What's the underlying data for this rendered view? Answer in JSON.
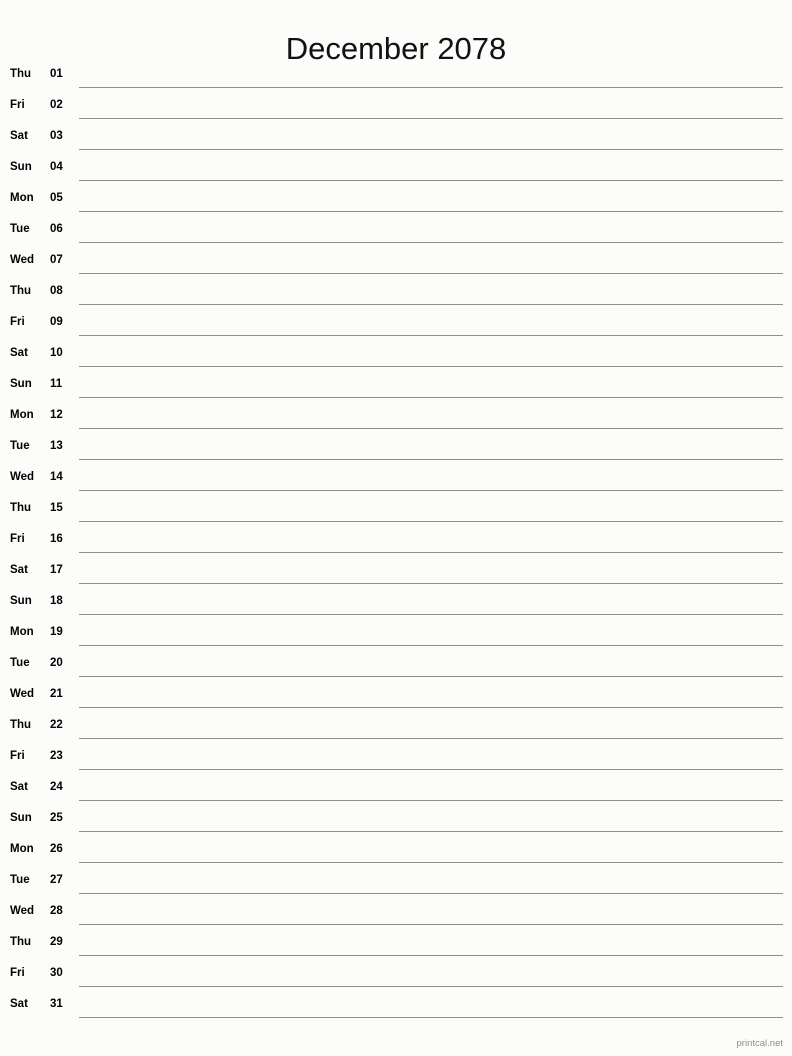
{
  "document": {
    "type": "printable-calendar",
    "title": "December 2078",
    "month": "December",
    "year": "2078",
    "orientation": "portrait",
    "layout": "single-column-notes"
  },
  "footer": {
    "source_label": "printcal.net"
  },
  "colors": {
    "background": "#fcfcfa",
    "text": "#000000",
    "rule": "#8a8f8a",
    "footer_text": "#8d8d8d"
  },
  "days": [
    {
      "weekday": "Thu",
      "date": "01"
    },
    {
      "weekday": "Fri",
      "date": "02"
    },
    {
      "weekday": "Sat",
      "date": "03"
    },
    {
      "weekday": "Sun",
      "date": "04"
    },
    {
      "weekday": "Mon",
      "date": "05"
    },
    {
      "weekday": "Tue",
      "date": "06"
    },
    {
      "weekday": "Wed",
      "date": "07"
    },
    {
      "weekday": "Thu",
      "date": "08"
    },
    {
      "weekday": "Fri",
      "date": "09"
    },
    {
      "weekday": "Sat",
      "date": "10"
    },
    {
      "weekday": "Sun",
      "date": "11"
    },
    {
      "weekday": "Mon",
      "date": "12"
    },
    {
      "weekday": "Tue",
      "date": "13"
    },
    {
      "weekday": "Wed",
      "date": "14"
    },
    {
      "weekday": "Thu",
      "date": "15"
    },
    {
      "weekday": "Fri",
      "date": "16"
    },
    {
      "weekday": "Sat",
      "date": "17"
    },
    {
      "weekday": "Sun",
      "date": "18"
    },
    {
      "weekday": "Mon",
      "date": "19"
    },
    {
      "weekday": "Tue",
      "date": "20"
    },
    {
      "weekday": "Wed",
      "date": "21"
    },
    {
      "weekday": "Thu",
      "date": "22"
    },
    {
      "weekday": "Fri",
      "date": "23"
    },
    {
      "weekday": "Sat",
      "date": "24"
    },
    {
      "weekday": "Sun",
      "date": "25"
    },
    {
      "weekday": "Mon",
      "date": "26"
    },
    {
      "weekday": "Tue",
      "date": "27"
    },
    {
      "weekday": "Wed",
      "date": "28"
    },
    {
      "weekday": "Thu",
      "date": "29"
    },
    {
      "weekday": "Fri",
      "date": "30"
    },
    {
      "weekday": "Sat",
      "date": "31"
    }
  ]
}
